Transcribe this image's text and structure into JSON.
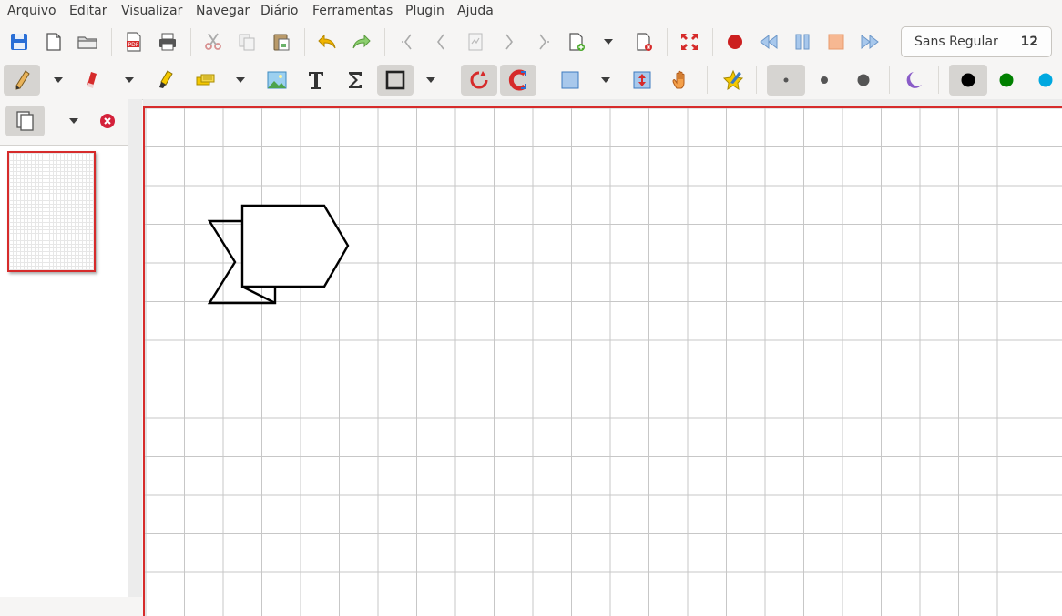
{
  "menu": {
    "items": [
      "Arquivo",
      "Editar",
      "Visualizar",
      "Navegar",
      "Diário",
      "Ferramentas",
      "Plugin",
      "Ajuda"
    ]
  },
  "toolbar1": {
    "icons": [
      "save-icon",
      "new-page-icon",
      "open-folder-icon",
      "export-pdf-icon",
      "print-icon",
      "cut-icon",
      "copy-icon",
      "paste-icon",
      "undo-icon",
      "redo-icon",
      "first-page-icon",
      "previous-page-icon",
      "go-to-page-icon",
      "next-page-icon",
      "last-page-icon",
      "add-page-icon",
      "delete-page-icon",
      "fullscreen-icon",
      "record-icon",
      "rewind-icon",
      "pause-icon",
      "stop-icon",
      "fast-forward-icon"
    ]
  },
  "font": {
    "name": "Sans Regular",
    "size": "12"
  },
  "toolbar2": {
    "icons": [
      "pen-icon",
      "eraser-icon",
      "highlighter-icon",
      "text-select-icon",
      "image-icon",
      "text-icon",
      "formula-icon",
      "shape-icon",
      "rotate-snap-icon",
      "grid-snap-icon",
      "rectangle-select-icon",
      "vertical-space-icon",
      "hand-icon",
      "default-tool-icon",
      "thin-line-icon",
      "medium-line-icon",
      "thick-line-icon",
      "fill-icon"
    ],
    "colors": {
      "black": "#000000",
      "green": "#008000",
      "cyan": "#00a8e0",
      "fill": "#8a5cc8"
    }
  },
  "accent": "#d62b2b"
}
